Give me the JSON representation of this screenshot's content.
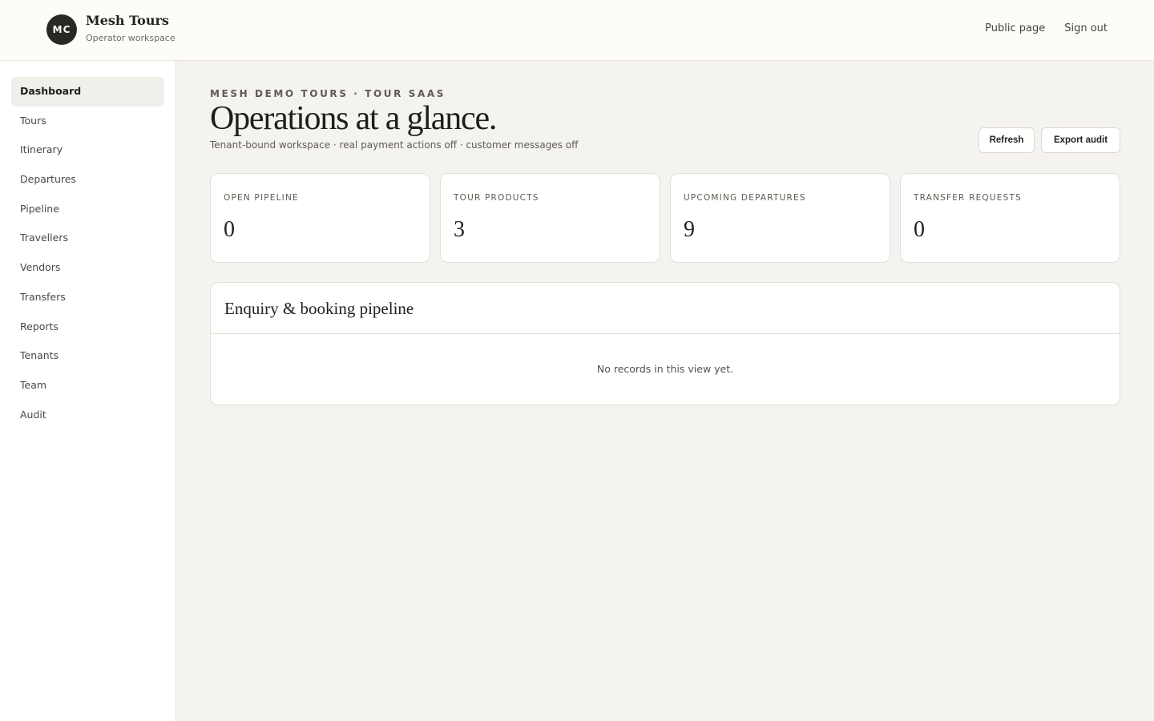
{
  "header": {
    "avatar_initials": "MC",
    "brand_name": "Mesh Tours",
    "brand_sub": "Operator workspace",
    "nav": [
      "Public page",
      "Sign out"
    ]
  },
  "sidebar": {
    "items": [
      {
        "label": "Dashboard",
        "active": true
      },
      {
        "label": "Tours"
      },
      {
        "label": "Itinerary"
      },
      {
        "label": "Departures"
      },
      {
        "label": "Pipeline"
      },
      {
        "label": "Travellers"
      },
      {
        "label": "Vendors"
      },
      {
        "label": "Transfers"
      },
      {
        "label": "Reports"
      },
      {
        "label": "Tenants"
      },
      {
        "label": "Team"
      },
      {
        "label": "Audit"
      }
    ]
  },
  "main": {
    "eyebrow": "MESH DEMO TOURS · TOUR SAAS",
    "title": "Operations at a glance.",
    "subtitle": "Tenant-bound workspace · real payment actions off · customer messages off",
    "actions": {
      "refresh": "Refresh",
      "export": "Export audit"
    },
    "stats": [
      {
        "label": "OPEN PIPELINE",
        "value": "0"
      },
      {
        "label": "TOUR PRODUCTS",
        "value": "3"
      },
      {
        "label": "UPCOMING DEPARTURES",
        "value": "9"
      },
      {
        "label": "TRANSFER REQUESTS",
        "value": "0"
      }
    ],
    "panel": {
      "title": "Enquiry & booking pipeline",
      "empty": "No records in this view yet."
    }
  },
  "colors": {
    "background": "#f4f3ef",
    "avatar": "#2a2822",
    "active_nav": "#eef1ea"
  }
}
